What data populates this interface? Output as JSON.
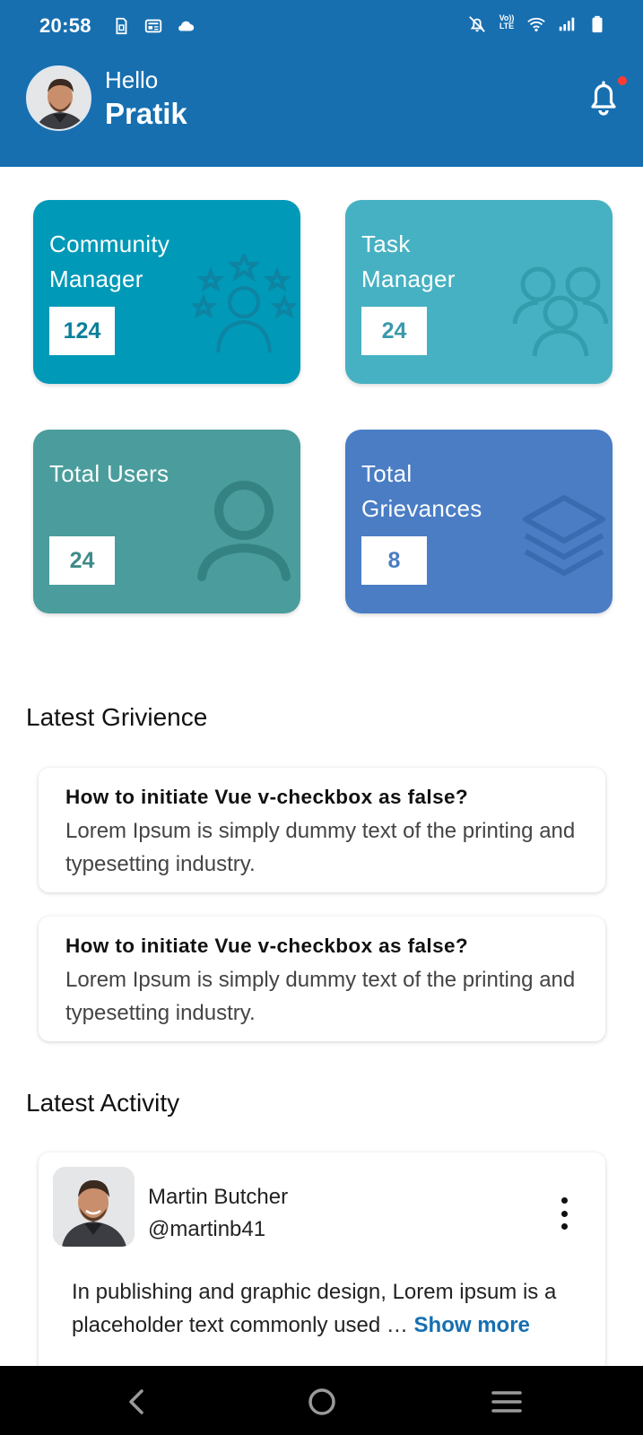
{
  "status_bar": {
    "time": "20:58",
    "left_icons": [
      "sim-card-icon",
      "news-icon",
      "cloud-icon"
    ],
    "right_icons": [
      "bell-off-icon",
      "volte-icon",
      "wifi-icon",
      "signal-icon",
      "battery-icon"
    ],
    "volte_label_top": "Vo))",
    "volte_label_bottom": "LTE"
  },
  "header": {
    "greeting": "Hello",
    "username": "Pratik",
    "notification_icon": "bell-icon",
    "notification_dot_color": "#ff3b30",
    "background_color": "#176fb0"
  },
  "stats": [
    {
      "title": "Community Manager",
      "line1": "Community",
      "line2": "Manager",
      "count": "124",
      "icon": "community-stars-icon",
      "color": "#0099b8"
    },
    {
      "title": "Task Manager",
      "line1": "Task",
      "line2": "Manager",
      "count": "24",
      "icon": "group-users-icon",
      "color": "#46b1c2"
    },
    {
      "title": "Total Users",
      "line1": "Total Users",
      "line2": "",
      "count": "24",
      "icon": "user-icon",
      "color": "#4a9d9c"
    },
    {
      "title": "Total Grievances",
      "line1": "Total",
      "line2": "Grievances",
      "count": "8",
      "icon": "layers-icon",
      "color": "#4a7dc4"
    }
  ],
  "latest_grievance": {
    "section_title": "Latest Grivience",
    "items": [
      {
        "title": "How to initiate Vue v-checkbox as false?",
        "body": "Lorem Ipsum is simply dummy text of the printing and typesetting industry."
      },
      {
        "title": "How to initiate Vue v-checkbox as false?",
        "body": "Lorem Ipsum is simply dummy text of the printing and typesetting industry."
      }
    ]
  },
  "latest_activity": {
    "section_title": "Latest Activity",
    "items": [
      {
        "name": "Martin Butcher",
        "handle": "@martinb41",
        "body": "In publishing and graphic design, Lorem ipsum is a placeholder text commonly used …",
        "show_more": "Show more"
      }
    ]
  },
  "navbar": {
    "buttons": [
      "back-icon",
      "home-icon",
      "recent-apps-icon"
    ]
  }
}
